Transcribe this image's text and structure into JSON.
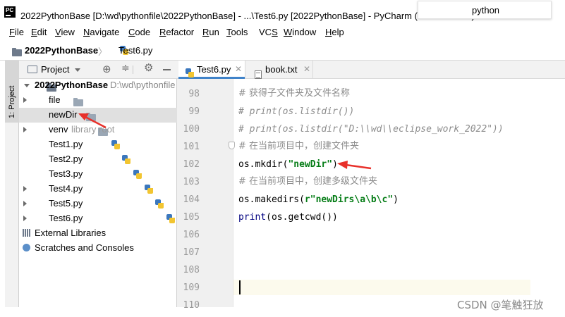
{
  "window": {
    "title": "2022PythonBase [D:\\wd\\pythonfile\\2022PythonBase] - ...\\Test6.py [2022PythonBase] - PyCharm (Administrator)",
    "app_icon_text": "PC",
    "tooltip_text": "python"
  },
  "menu": [
    {
      "label": "File",
      "mnemonic": "F",
      "rest": "ile"
    },
    {
      "label": "Edit",
      "mnemonic": "E",
      "rest": "dit"
    },
    {
      "label": "View",
      "mnemonic": "V",
      "rest": "iew"
    },
    {
      "label": "Navigate",
      "mnemonic": "N",
      "rest": "avigate"
    },
    {
      "label": "Code",
      "mnemonic": "C",
      "rest": "ode"
    },
    {
      "label": "Refactor",
      "mnemonic": "R",
      "rest": "efactor"
    },
    {
      "label": "Run",
      "mnemonic": "R",
      "rest": "un"
    },
    {
      "label": "Tools",
      "mnemonic": "T",
      "rest": "ools"
    },
    {
      "label": "VCS",
      "mnemonic": "S",
      "rest": "VC"
    },
    {
      "label": "Window",
      "mnemonic": "W",
      "rest": "indow"
    },
    {
      "label": "Help",
      "mnemonic": "H",
      "rest": "elp"
    }
  ],
  "breadcrumb": {
    "project": "2022PythonBase",
    "file": "Test6.py"
  },
  "sidebar": {
    "tab_label": "1: Project"
  },
  "project_panel": {
    "view_label": "Project",
    "root": {
      "name": "2022PythonBase",
      "path": "D:\\wd\\pythonfile"
    },
    "items": [
      {
        "name": "file",
        "kind": "folder",
        "note": ""
      },
      {
        "name": "newDir",
        "kind": "folder",
        "note": ""
      },
      {
        "name": "venv",
        "kind": "folder",
        "note": "library root"
      },
      {
        "name": "Test1.py",
        "kind": "python",
        "note": ""
      },
      {
        "name": "Test2.py",
        "kind": "python",
        "note": ""
      },
      {
        "name": "Test3.py",
        "kind": "python",
        "note": ""
      },
      {
        "name": "Test4.py",
        "kind": "python",
        "note": ""
      },
      {
        "name": "Test5.py",
        "kind": "python",
        "note": ""
      },
      {
        "name": "Test6.py",
        "kind": "python",
        "note": ""
      }
    ],
    "external_libraries": "External Libraries",
    "scratches": "Scratches and Consoles"
  },
  "editor_tabs": [
    {
      "label": "Test6.py",
      "active": true
    },
    {
      "label": "book.txt",
      "active": false
    }
  ],
  "code": {
    "line_numbers": [
      "98",
      "99",
      "100",
      "101",
      "102",
      "103",
      "104",
      "105",
      "106",
      "107",
      "108",
      "109",
      "110"
    ],
    "l98": "# 获得子文件夹及文件名称",
    "l99": "# print(os.listdir())",
    "l100": "# print(os.listdir(\"D:\\\\wd\\\\eclipse_work_2022\"))",
    "l101": "# 在当前项目中，创建文件夹",
    "l102_fn": "os.mkdir(",
    "l102_str": "\"newDir\"",
    "l102_end": ")",
    "l103": "# 在当前项目中，创建多级文件夹",
    "l104_fn": "os.makedirs(",
    "l104_str": "r\"newDirs\\a\\b\\c\"",
    "l104_end": ")",
    "l105_kw": "print",
    "l105_rest": "(os.getcwd())"
  },
  "watermark": "CSDN @笔触狂放",
  "colors": {
    "annotation_arrow": "#e8302a",
    "active_tab_underline": "#4083c9",
    "string": "#067d17",
    "comment": "#8c8c8c"
  }
}
